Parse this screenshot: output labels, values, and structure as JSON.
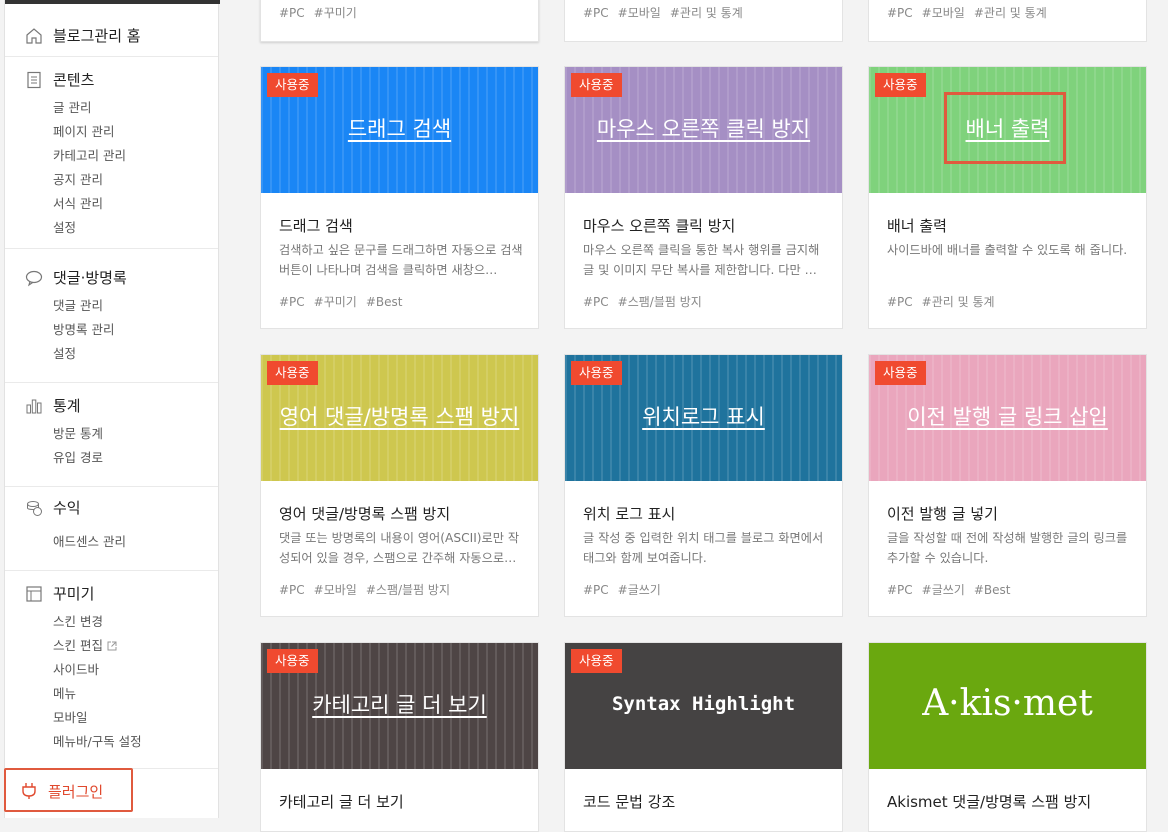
{
  "sidebar": {
    "home": "블로그관리 홈",
    "sections": [
      {
        "icon": "document-icon",
        "title": "콘텐츠",
        "items": [
          "글 관리",
          "페이지 관리",
          "카테고리 관리",
          "공지 관리",
          "서식 관리",
          "설정"
        ]
      },
      {
        "icon": "speech-bubble-icon",
        "title": "댓글·방명록",
        "items": [
          "댓글 관리",
          "방명록 관리",
          "설정"
        ]
      },
      {
        "icon": "bar-chart-icon",
        "title": "통계",
        "items": [
          "방문 통계",
          "유입 경로"
        ]
      },
      {
        "icon": "coins-icon",
        "title": "수익",
        "items": [
          "애드센스 관리"
        ]
      },
      {
        "icon": "layout-icon",
        "title": "꾸미기",
        "items": [
          "스킨 변경",
          "스킨 편집",
          "사이드바",
          "메뉴",
          "모바일",
          "메뉴바/구독 설정"
        ]
      }
    ],
    "plugin": "플러그인"
  },
  "top_cards": [
    {
      "tags": [
        "#PC",
        "#꾸미기"
      ]
    },
    {
      "tags": [
        "#PC",
        "#모바일",
        "#관리 및 통계"
      ]
    },
    {
      "tags": [
        "#PC",
        "#모바일",
        "#관리 및 통계"
      ]
    }
  ],
  "cards": [
    {
      "badge": "사용중",
      "thumb_title": "드래그 검색",
      "name": "드래그 검색",
      "desc": "검색하고 싶은 문구를 드래그하면 자동으로 검색 버튼이 나타나며 검색을 클릭하면 새창으…",
      "tags": [
        "#PC",
        "#꾸미기",
        "#Best"
      ],
      "color": "#1a86f5"
    },
    {
      "badge": "사용중",
      "thumb_title": "마우스 오른쪽 클릭 방지",
      "name": "마우스 오른쪽 클릭 방지",
      "desc": "마우스 오른쪽 클릭을 통한 복사 행위를 금지해 글 및 이미지 무단 복사를 제한합니다. 다만 …",
      "tags": [
        "#PC",
        "#스팸/블펌 방지"
      ],
      "color": "#a58fc4"
    },
    {
      "badge": "사용중",
      "thumb_title": "배너 출력",
      "name": "배너 출력",
      "desc": "사이드바에 배너를 출력할 수 있도록 해 줍니다.",
      "tags": [
        "#PC",
        "#관리 및 통계"
      ],
      "color": "#7fd27c"
    },
    {
      "badge": "사용중",
      "thumb_title": "영어 댓글/방명록 스팸 방지",
      "name": "영어 댓글/방명록 스팸 방지",
      "desc": "댓글 또는 방명록의 내용이 영어(ASCII)로만 작성되어 있을 경우, 스팸으로 간주해 자동으로…",
      "tags": [
        "#PC",
        "#모바일",
        "#스팸/블펌 방지"
      ],
      "color": "#cec74f"
    },
    {
      "badge": "사용중",
      "thumb_title": "위치로그 표시",
      "name": "위치 로그 표시",
      "desc": "글 작성 중 입력한 위치 태그를 블로그 화면에서 태그와 함께 보여줍니다.",
      "tags": [
        "#PC",
        "#글쓰기"
      ],
      "color": "#1f739d"
    },
    {
      "badge": "사용중",
      "thumb_title": "이전 발행 글 링크 삽입",
      "name": "이전 발행 글 넣기",
      "desc": "글을 작성할 때 전에 작성해 발행한 글의 링크를 추가할 수 있습니다.",
      "tags": [
        "#PC",
        "#글쓰기",
        "#Best"
      ],
      "color": "#eaa6bd"
    },
    {
      "badge": "사용중",
      "thumb_title": "카테고리 글 더 보기",
      "name": "카테고리 글 더 보기",
      "desc": "",
      "tags": [],
      "color": "#4e4545"
    },
    {
      "badge": "사용중",
      "thumb_title": "Syntax Highlight",
      "name": "코드 문법 강조",
      "desc": "",
      "tags": [],
      "color": "#454343"
    },
    {
      "badge": "",
      "thumb_title": "A·kis·met",
      "name": "Akismet 댓글/방명록 스팸 방지",
      "desc": "",
      "tags": [],
      "color": "#6aa80f"
    }
  ],
  "colors": {
    "badge": "#f04a2f",
    "highlight": "#e05a3e"
  }
}
